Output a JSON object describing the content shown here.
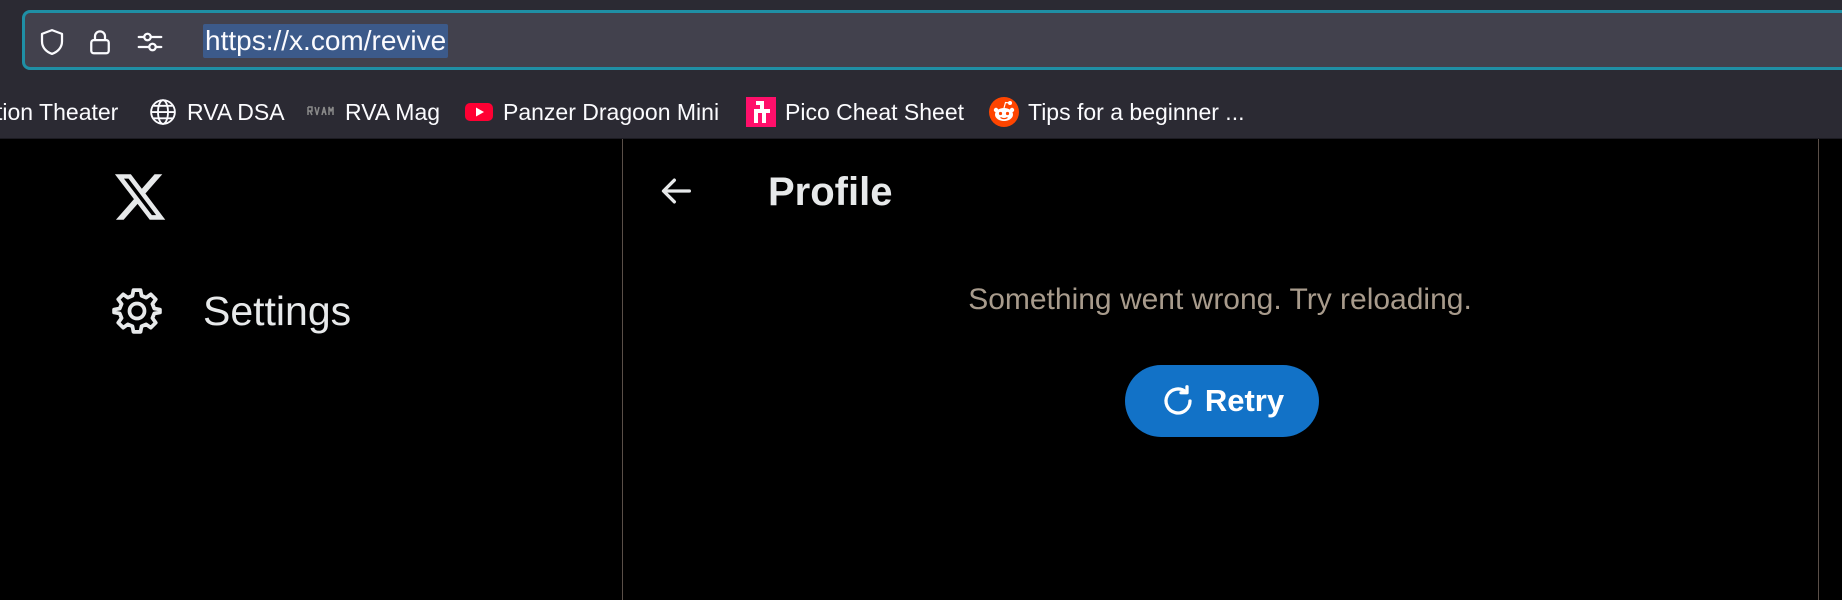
{
  "browser": {
    "url": "https://x.com/revive",
    "icons": {
      "tracking_protection": "shield-icon",
      "security": "lock-icon",
      "permissions": "sliders-icon"
    },
    "accent_color": "#1f8fa5"
  },
  "bookmarks": [
    {
      "label": "tion Theater",
      "icon": "none"
    },
    {
      "label": "RVA DSA",
      "icon": "globe-icon"
    },
    {
      "label": "RVA Mag",
      "icon": "rva-mag-favicon"
    },
    {
      "label": "Panzer Dragoon Mini",
      "icon": "youtube-icon"
    },
    {
      "label": "Pico Cheat Sheet",
      "icon": "pico-favicon"
    },
    {
      "label": "Tips for a beginner ...",
      "icon": "reddit-icon"
    }
  ],
  "sidebar": {
    "logo": "x-logo",
    "items": [
      {
        "label": "Settings",
        "icon": "gear-icon"
      }
    ]
  },
  "main": {
    "title": "Profile",
    "back_icon": "arrow-left-icon",
    "error_message": "Something went wrong. Try reloading.",
    "retry_label": "Retry",
    "retry_icon": "refresh-icon",
    "retry_color": "#1272c7"
  }
}
